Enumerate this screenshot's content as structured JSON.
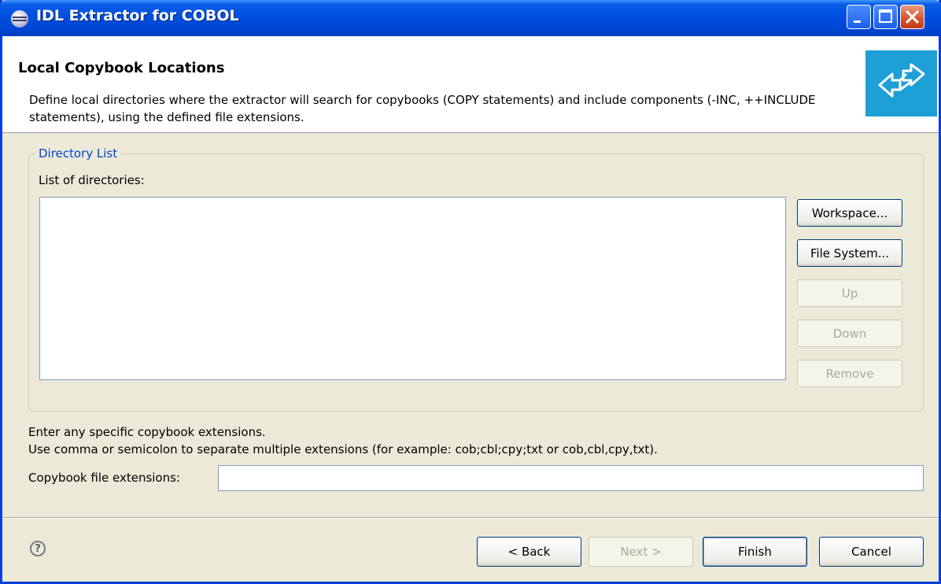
{
  "window": {
    "title": "IDL Extractor for COBOL",
    "controls": {
      "minimize": "minimize-icon",
      "maximize": "maximize-icon",
      "close": "close-icon"
    }
  },
  "header": {
    "title": "Local Copybook Locations",
    "description": "Define local directories where the extractor will search for copybooks (COPY statements) and include components (-INC, ++INCLUDE statements), using the defined file extensions.",
    "banner_icon": "import-arrows-icon",
    "banner_color": "#1e9fd6"
  },
  "directory_group": {
    "legend": "Directory List",
    "list_label": "List of directories:",
    "items": [],
    "buttons": {
      "workspace": "Workspace...",
      "file_system": "File System...",
      "up": "Up",
      "down": "Down",
      "remove": "Remove"
    }
  },
  "extensions": {
    "note_line1": "Enter any specific copybook extensions.",
    "note_line2": "Use comma or semicolon to separate multiple extensions (for example: cob;cbl;cpy;txt or cob,cbl,cpy,txt).",
    "label": "Copybook file extensions:",
    "value": ""
  },
  "footer": {
    "help_icon": "help-icon",
    "back": "< Back",
    "next": "Next >",
    "finish": "Finish",
    "cancel": "Cancel"
  }
}
